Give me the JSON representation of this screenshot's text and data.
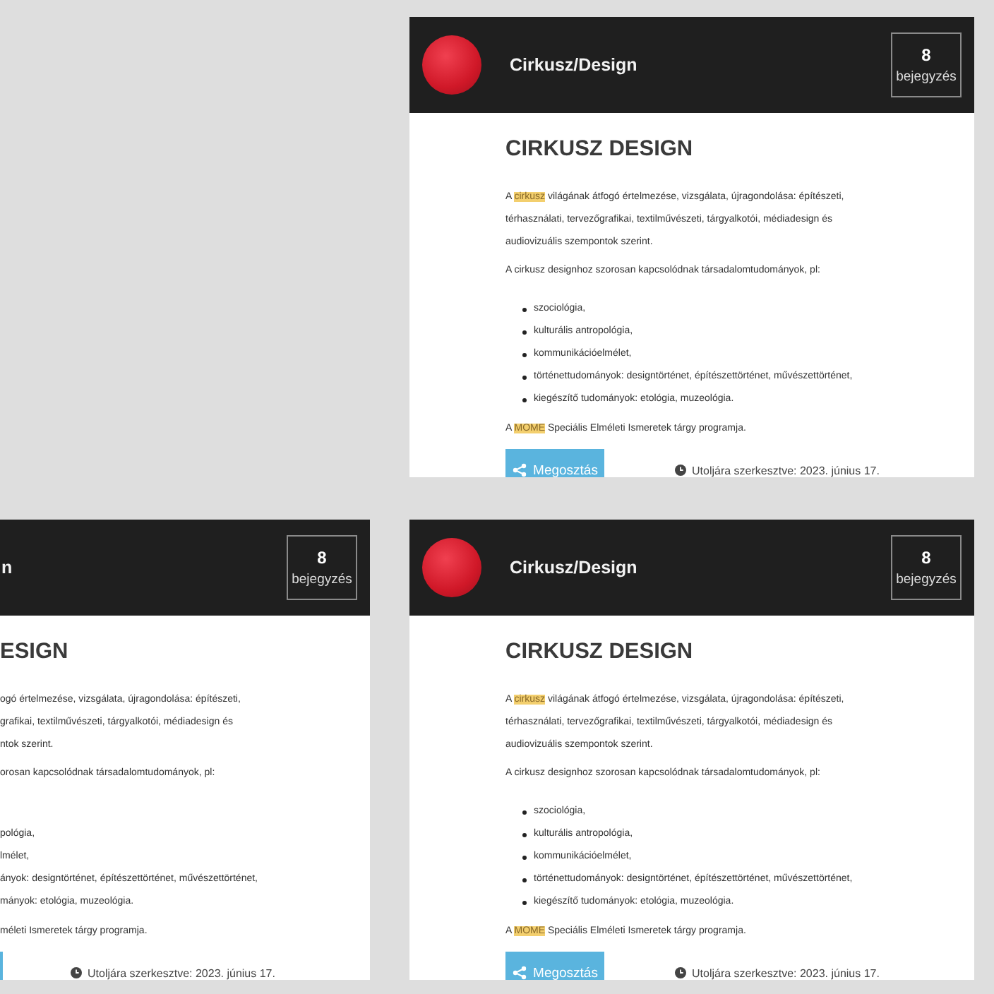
{
  "cards": [
    {
      "kind": "full",
      "title": "Cirkusz/Design",
      "count": "8",
      "count_label": "bejegyzés",
      "heading": "CIRKUSZ DESIGN",
      "intro_paragraphs": [
        [
          [
            {
              "text": "A ",
              "highlighted": false
            },
            {
              "text": "cirkusz",
              "highlighted": true
            },
            {
              "text": " világának átfogó értelmezése, vizsgálata, újragondolása: építészeti,",
              "highlighted": false
            }
          ],
          [
            {
              "text": "térhasználati, tervezőgrafikai, textilművészeti, tárgyalkotói, médiadesign és",
              "highlighted": false
            }
          ],
          [
            {
              "text": "audiovizuális szempontok szerint.",
              "highlighted": false
            }
          ]
        ],
        [
          [
            {
              "text": "A cirkusz designhoz szorosan kapcsolódnak társadalomtudományok, pl:",
              "highlighted": false
            }
          ]
        ]
      ],
      "list_items": [
        "szociológia,",
        "kulturális antropológia,",
        "kommunikációelmélet,",
        "történettudományok: designtörténet, építészettörténet, művészettörténet,",
        "kiegészítő tudományok: etológia, muzeológia."
      ],
      "closing_paragraph": [
        {
          "text": "A ",
          "highlighted": false
        },
        {
          "text": "MOME",
          "highlighted": true
        },
        {
          "text": " Speciális Elméleti Ismeretek tárgy programja.",
          "highlighted": false
        }
      ],
      "share_label": "Megosztás",
      "edited": "Utoljára szerkesztve: 2023. június 17."
    },
    {
      "kind": "cropped",
      "title": "n",
      "count": "8",
      "count_label": "bejegyzés",
      "heading": "ESIGN",
      "intro_paragraphs": [
        [
          [
            {
              "text": "ogó értelmezése, vizsgálata, újragondolása: építészeti,",
              "highlighted": false
            }
          ],
          [
            {
              "text": "grafikai, textilművészeti, tárgyalkotói, médiadesign és",
              "highlighted": false
            }
          ],
          [
            {
              "text": "ntok szerint.",
              "highlighted": false
            }
          ]
        ],
        [
          [
            {
              "text": "orosan kapcsolódnak társadalomtudományok, pl:",
              "highlighted": false
            }
          ]
        ]
      ],
      "list_items": [
        "pológia,",
        "lmélet,",
        "ányok: designtörténet, építészettörténet, művészettörténet,",
        "mányok: etológia, muzeológia."
      ],
      "closing_paragraph": [
        {
          "text": "méleti Ismeretek tárgy programja.",
          "highlighted": false
        }
      ],
      "edited": "Utoljára szerkesztve: 2023. június 17."
    },
    {
      "kind": "full",
      "title": "Cirkusz/Design",
      "count": "8",
      "count_label": "bejegyzés",
      "heading": "CIRKUSZ DESIGN",
      "intro_paragraphs": [
        [
          [
            {
              "text": "A ",
              "highlighted": false
            },
            {
              "text": "cirkusz",
              "highlighted": true
            },
            {
              "text": " világának átfogó értelmezése, vizsgálata, újragondolása: építészeti,",
              "highlighted": false
            }
          ],
          [
            {
              "text": "térhasználati, tervezőgrafikai, textilművészeti, tárgyalkotói, médiadesign és",
              "highlighted": false
            }
          ],
          [
            {
              "text": "audiovizuális szempontok szerint.",
              "highlighted": false
            }
          ]
        ],
        [
          [
            {
              "text": "A cirkusz designhoz szorosan kapcsolódnak társadalomtudományok, pl:",
              "highlighted": false
            }
          ]
        ]
      ],
      "list_items": [
        "szociológia,",
        "kulturális antropológia,",
        "kommunikációelmélet,",
        "történettudományok: designtörténet, építészettörténet, művészettörténet,",
        "kiegészítő tudományok: etológia, muzeológia."
      ],
      "closing_paragraph": [
        {
          "text": "A ",
          "highlighted": false
        },
        {
          "text": "MOME",
          "highlighted": true
        },
        {
          "text": " Speciális Elméleti Ismeretek tárgy programja.",
          "highlighted": false
        }
      ],
      "share_label": "Megosztás",
      "edited": "Utoljára szerkesztve: 2023. június 17."
    }
  ]
}
